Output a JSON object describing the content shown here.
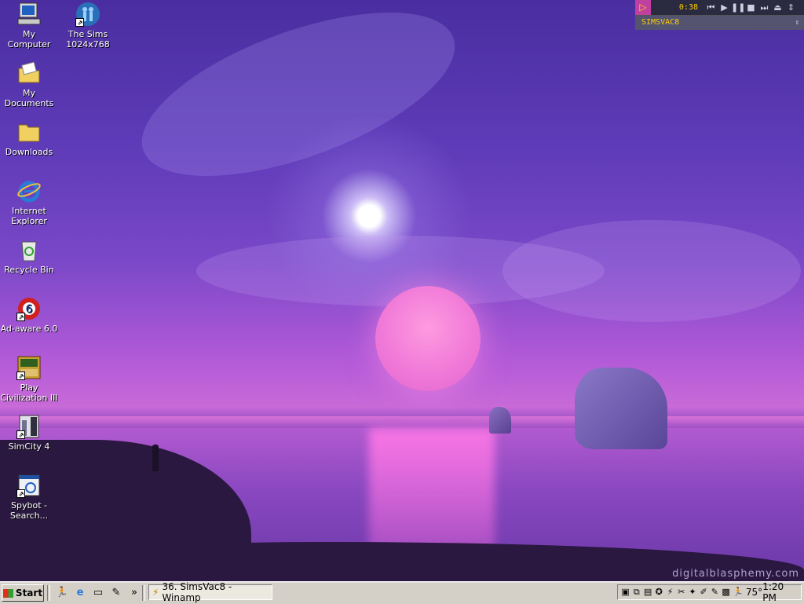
{
  "desktop": {
    "icons": [
      {
        "label": "My Computer",
        "icon": "computer-icon"
      },
      {
        "label": "The Sims 1024x768",
        "icon": "sims-icon"
      },
      {
        "label": "My Documents",
        "icon": "documents-folder-icon"
      },
      {
        "label": "Downloads",
        "icon": "folder-icon"
      },
      {
        "label": "Internet Explorer",
        "icon": "internet-explorer-icon"
      },
      {
        "label": "Recycle Bin",
        "icon": "recycle-bin-icon"
      },
      {
        "label": "Ad-aware 6.0",
        "icon": "adaware-icon"
      },
      {
        "label": "Play Civilization III",
        "icon": "civilization-icon"
      },
      {
        "label": "SimCity 4",
        "icon": "simcity-icon"
      },
      {
        "label": "Spybot - Search...",
        "icon": "spybot-icon"
      }
    ],
    "watermark": "digitalblasphemy.com"
  },
  "winamp": {
    "time": "0:38",
    "title": "SIMSVAC8"
  },
  "taskbar": {
    "start_label": "Start",
    "quick_launch_more": "»",
    "tasks": [
      {
        "label": "36. SimsVac8 - Winamp",
        "icon": "winamp-icon"
      }
    ],
    "tray": {
      "temperature": "75°",
      "clock": "1:20 PM"
    }
  }
}
